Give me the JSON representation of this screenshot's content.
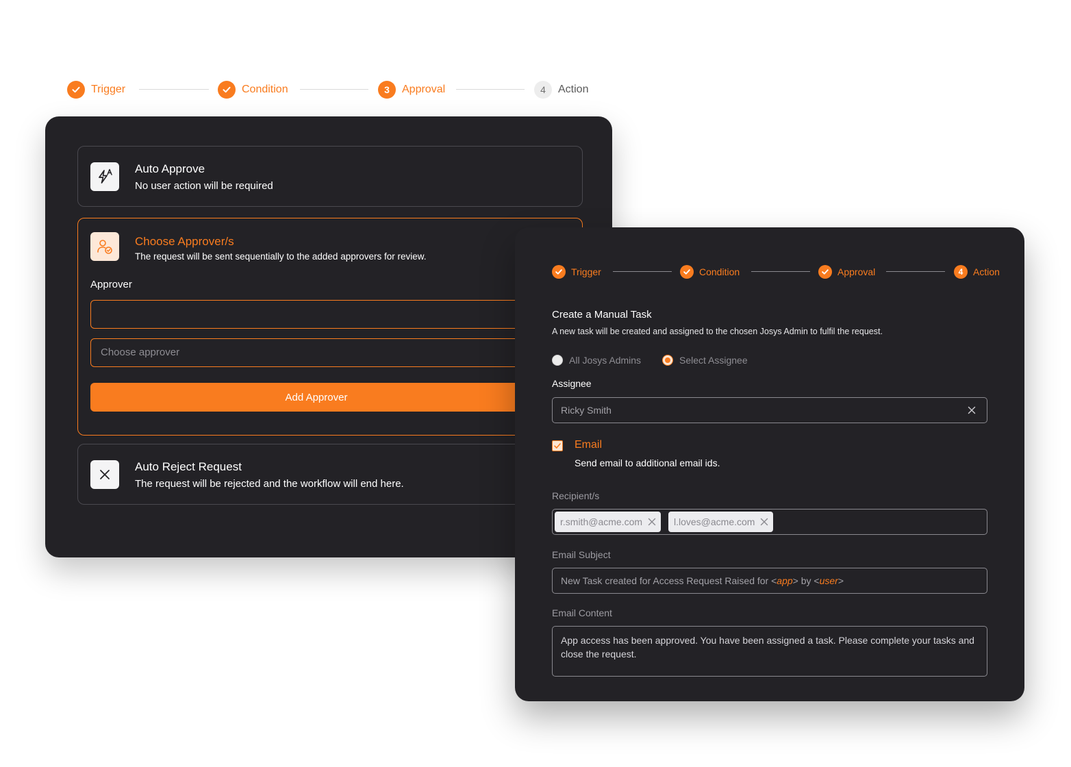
{
  "stepper": {
    "steps": [
      {
        "label": "Trigger",
        "state": "done"
      },
      {
        "label": "Condition",
        "state": "done"
      },
      {
        "label": "Approval",
        "state": "current",
        "number": "3"
      },
      {
        "label": "Action",
        "state": "todo",
        "number": "4"
      }
    ]
  },
  "approval_panel": {
    "auto_approve": {
      "title": "Auto Approve",
      "subtitle": "No user action will be required"
    },
    "choose_approvers": {
      "title": "Choose Approver/s",
      "subtitle": "The request will be sent sequentially to the added approvers for review.",
      "approver_label": "Approver",
      "approver_value": "",
      "select_placeholder": "Choose approver",
      "add_button": "Add Approver"
    },
    "auto_reject": {
      "title": "Auto Reject Request",
      "subtitle": "The request will be rejected and the workflow will end here."
    }
  },
  "action_panel": {
    "stepper": {
      "steps": [
        {
          "label": "Trigger",
          "state": "done"
        },
        {
          "label": "Condition",
          "state": "done"
        },
        {
          "label": "Approval",
          "state": "done"
        },
        {
          "label": "Action",
          "state": "current",
          "number": "4"
        }
      ]
    },
    "title": "Create a Manual Task",
    "subtitle": "A new task will be created and assigned to the chosen Josys Admin to fulfil the request.",
    "radio_options": [
      {
        "label": "All Josys Admins",
        "selected": false
      },
      {
        "label": "Select Assignee",
        "selected": true
      }
    ],
    "assignee_label": "Assignee",
    "assignee_value": "Ricky Smith",
    "email": {
      "checked": true,
      "title": "Email",
      "subtitle": "Send email to additional email ids."
    },
    "recipients_label": "Recipient/s",
    "recipients": [
      "r.smith@acme.com",
      "l.loves@acme.com"
    ],
    "subject_label": "Email Subject",
    "subject": {
      "prefix": "New Task created for Access Request Raised for ",
      "lt1": "<",
      "var1": "app",
      "gt1": ">",
      "mid": " by ",
      "lt2": "<",
      "var2": "user",
      "gt2": ">"
    },
    "content_label": "Email Content",
    "content": "App access has been approved. You have been assigned a task. Please complete your tasks and close the request."
  },
  "colors": {
    "accent": "#f97c1f",
    "panel": "#232226",
    "border": "#4a494f",
    "muted": "#8e8d93"
  },
  "icons": [
    "check-icon",
    "auto-approve-icon",
    "user-check-icon",
    "chevron-down-icon",
    "close-icon",
    "checkbox-check-icon"
  ]
}
